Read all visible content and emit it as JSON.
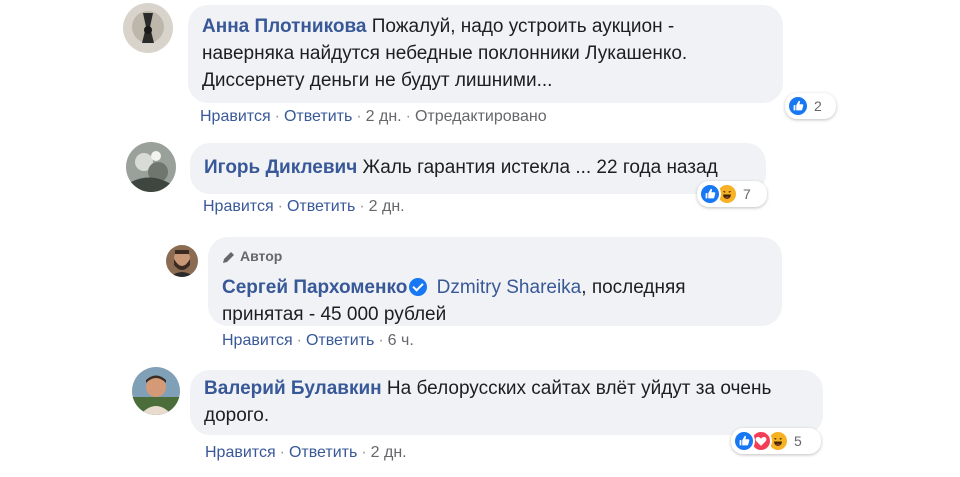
{
  "comments": [
    {
      "author": "Анна Плотникова",
      "text": "Пожалуй, надо устроить аукцион - наверняка найдутся небедные поклонники Лукашенко. Диссернету деньги не будут лишними...",
      "actions": {
        "like": "Нравится",
        "reply": "Ответить",
        "time": "2 дн.",
        "edited": "Отредактировано"
      },
      "reactions": {
        "icons": [
          "like-icon"
        ],
        "count": "2"
      }
    },
    {
      "author": "Игорь Диклевич",
      "text": "Жаль гарантия истекла ... 22 года назад",
      "actions": {
        "like": "Нравится",
        "reply": "Ответить",
        "time": "2 дн."
      },
      "reactions": {
        "icons": [
          "like-icon",
          "haha-icon"
        ],
        "count": "7"
      }
    },
    {
      "badge": "Автор",
      "author": "Сергей Пархоменко",
      "verified": true,
      "mention": "Dzmitry Shareika",
      "text": ", последняя принятая - 45 000 рублей",
      "actions": {
        "like": "Нравится",
        "reply": "Ответить",
        "time": "6 ч."
      }
    },
    {
      "author": "Валерий Булавкин",
      "text": "На белорусских сайтах влёт уйдут за очень дорого.",
      "actions": {
        "like": "Нравится",
        "reply": "Ответить",
        "time": "2 дн."
      },
      "reactions": {
        "icons": [
          "like-icon",
          "love-icon",
          "haha-icon"
        ],
        "count": "5"
      }
    }
  ],
  "sep": "·",
  "colors": {
    "link": "#385898",
    "bubble": "#f0f2f5",
    "meta": "#65676b",
    "like": "#1877f2",
    "love": "#f33e58",
    "haha": "#f7b125"
  }
}
